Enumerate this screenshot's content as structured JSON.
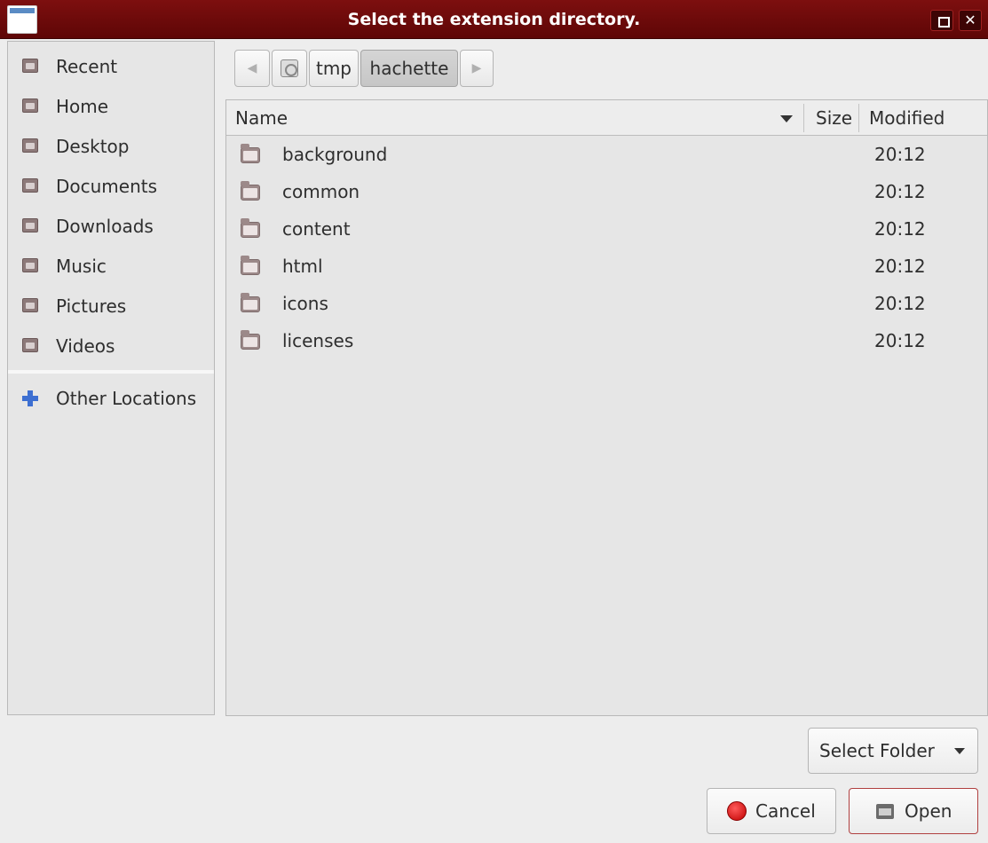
{
  "window": {
    "title": "Select the extension directory."
  },
  "sidebar": {
    "items": [
      {
        "label": "Recent",
        "icon": "recent-icon"
      },
      {
        "label": "Home",
        "icon": "home-icon"
      },
      {
        "label": "Desktop",
        "icon": "desktop-icon"
      },
      {
        "label": "Documents",
        "icon": "documents-icon"
      },
      {
        "label": "Downloads",
        "icon": "downloads-icon"
      },
      {
        "label": "Music",
        "icon": "music-icon"
      },
      {
        "label": "Pictures",
        "icon": "pictures-icon"
      },
      {
        "label": "Videos",
        "icon": "videos-icon"
      }
    ],
    "other_locations": "Other Locations"
  },
  "pathbar": {
    "segments": [
      "tmp",
      "hachette"
    ],
    "active": "hachette"
  },
  "filelist": {
    "columns": {
      "name": "Name",
      "size": "Size",
      "modified": "Modified"
    },
    "rows": [
      {
        "name": "background",
        "size": "",
        "modified": "20:12"
      },
      {
        "name": "common",
        "size": "",
        "modified": "20:12"
      },
      {
        "name": "content",
        "size": "",
        "modified": "20:12"
      },
      {
        "name": "html",
        "size": "",
        "modified": "20:12"
      },
      {
        "name": "icons",
        "size": "",
        "modified": "20:12"
      },
      {
        "name": "licenses",
        "size": "",
        "modified": "20:12"
      }
    ]
  },
  "footer": {
    "filter_label": "Select Folder",
    "cancel_label": "Cancel",
    "open_label": "Open"
  },
  "colors": {
    "titlebar": "#6e0a0a",
    "accent_plus": "#3d6fd1"
  }
}
